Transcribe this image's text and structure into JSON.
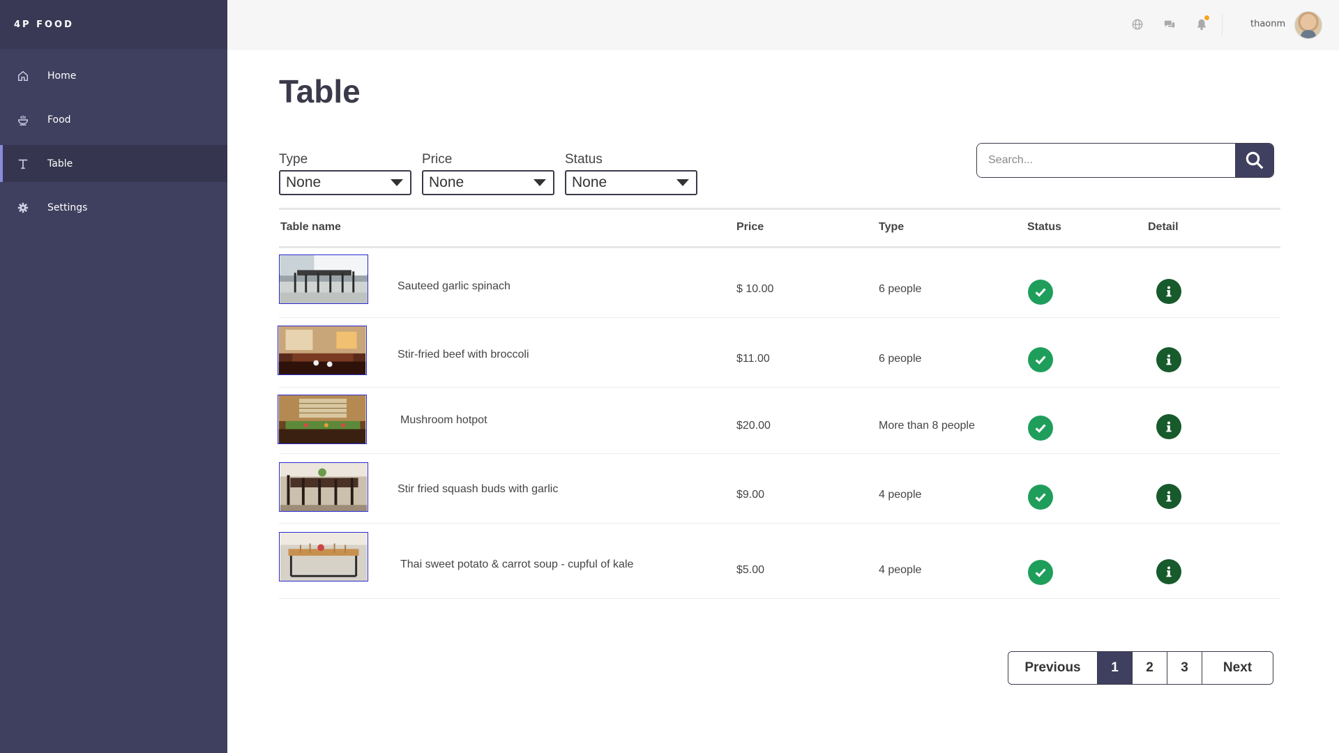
{
  "brand": "4P FOOD",
  "sidebar": {
    "items": [
      {
        "label": "Home",
        "icon": "home-icon",
        "active": false
      },
      {
        "label": "Food",
        "icon": "food-bowl-icon",
        "active": false
      },
      {
        "label": "Table",
        "icon": "table-icon",
        "active": true
      },
      {
        "label": "Settings",
        "icon": "gear-icon",
        "active": false
      }
    ]
  },
  "topbar": {
    "icons": [
      "globe-icon",
      "chat-icon",
      "bell-icon"
    ],
    "username": "thaonm"
  },
  "page": {
    "title": "Table"
  },
  "filters": {
    "type": {
      "label": "Type",
      "value": "None"
    },
    "price": {
      "label": "Price",
      "value": "None"
    },
    "status": {
      "label": "Status",
      "value": "None"
    }
  },
  "search": {
    "placeholder": "Search..."
  },
  "table": {
    "headers": {
      "name": "Table name",
      "price": "Price",
      "type": "Type",
      "status": "Status",
      "detail": "Detail"
    },
    "rows": [
      {
        "name": "Sauteed garlic spinach",
        "price": "$ 10.00",
        "type": "6 people",
        "status": "available",
        "image": "dining-room-patio"
      },
      {
        "name": "Stir-fried beef with broccoli",
        "price": "$11.00",
        "type": "6 people",
        "status": "available",
        "image": "dining-room-warm-lit"
      },
      {
        "name": "Mushroom hotpot",
        "price": "$20.00",
        "type": "More than 8 people",
        "status": "available",
        "image": "dining-room-long-table"
      },
      {
        "name": "Stir fried squash buds with garlic",
        "price": "$9.00",
        "type": "4 people",
        "status": "available",
        "image": "dining-room-dark-wood"
      },
      {
        "name": "Thai sweet potato & carrot soup - cupful of kale",
        "price": "$5.00",
        "type": "4 people",
        "status": "available",
        "image": "dining-room-wooden-table"
      }
    ]
  },
  "pagination": {
    "previous": "Previous",
    "pages": [
      "1",
      "2",
      "3"
    ],
    "current": "1",
    "next": "Next"
  },
  "colors": {
    "sidebar": "#3f3f5f",
    "active_indicator": "#8b8bdc",
    "status_green": "#1e9e5a",
    "info_green": "#175a2c",
    "notification_dot": "#f5a623"
  }
}
